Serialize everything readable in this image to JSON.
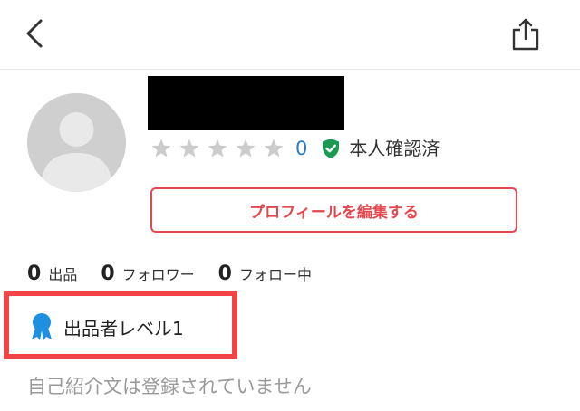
{
  "header": {
    "back_icon": "chevron-left-icon",
    "share_icon": "share-icon"
  },
  "profile": {
    "avatar_icon": "user-silhouette-icon",
    "name_redacted": true,
    "rating": {
      "stars_total": 5,
      "stars_filled": 0,
      "star_color_inactive": "#cccccc",
      "count": "0",
      "count_color": "#2b7bbf"
    },
    "verified": {
      "icon": "shield-check-icon",
      "icon_color": "#1a9a52",
      "label": "本人確認済"
    },
    "edit_button_label": "プロフィールを編集する",
    "accent_color": "#e4474d"
  },
  "stats": [
    {
      "value": "0",
      "label": "出品"
    },
    {
      "value": "0",
      "label": "フォロワー"
    },
    {
      "value": "0",
      "label": "フォロー中"
    }
  ],
  "seller_level": {
    "icon": "medal-icon",
    "icon_color": "#1f8fe0",
    "label": "出品者レベル1",
    "highlight_color": "#f24346"
  },
  "bio": {
    "text": "自己紹介文は登録されていません"
  }
}
